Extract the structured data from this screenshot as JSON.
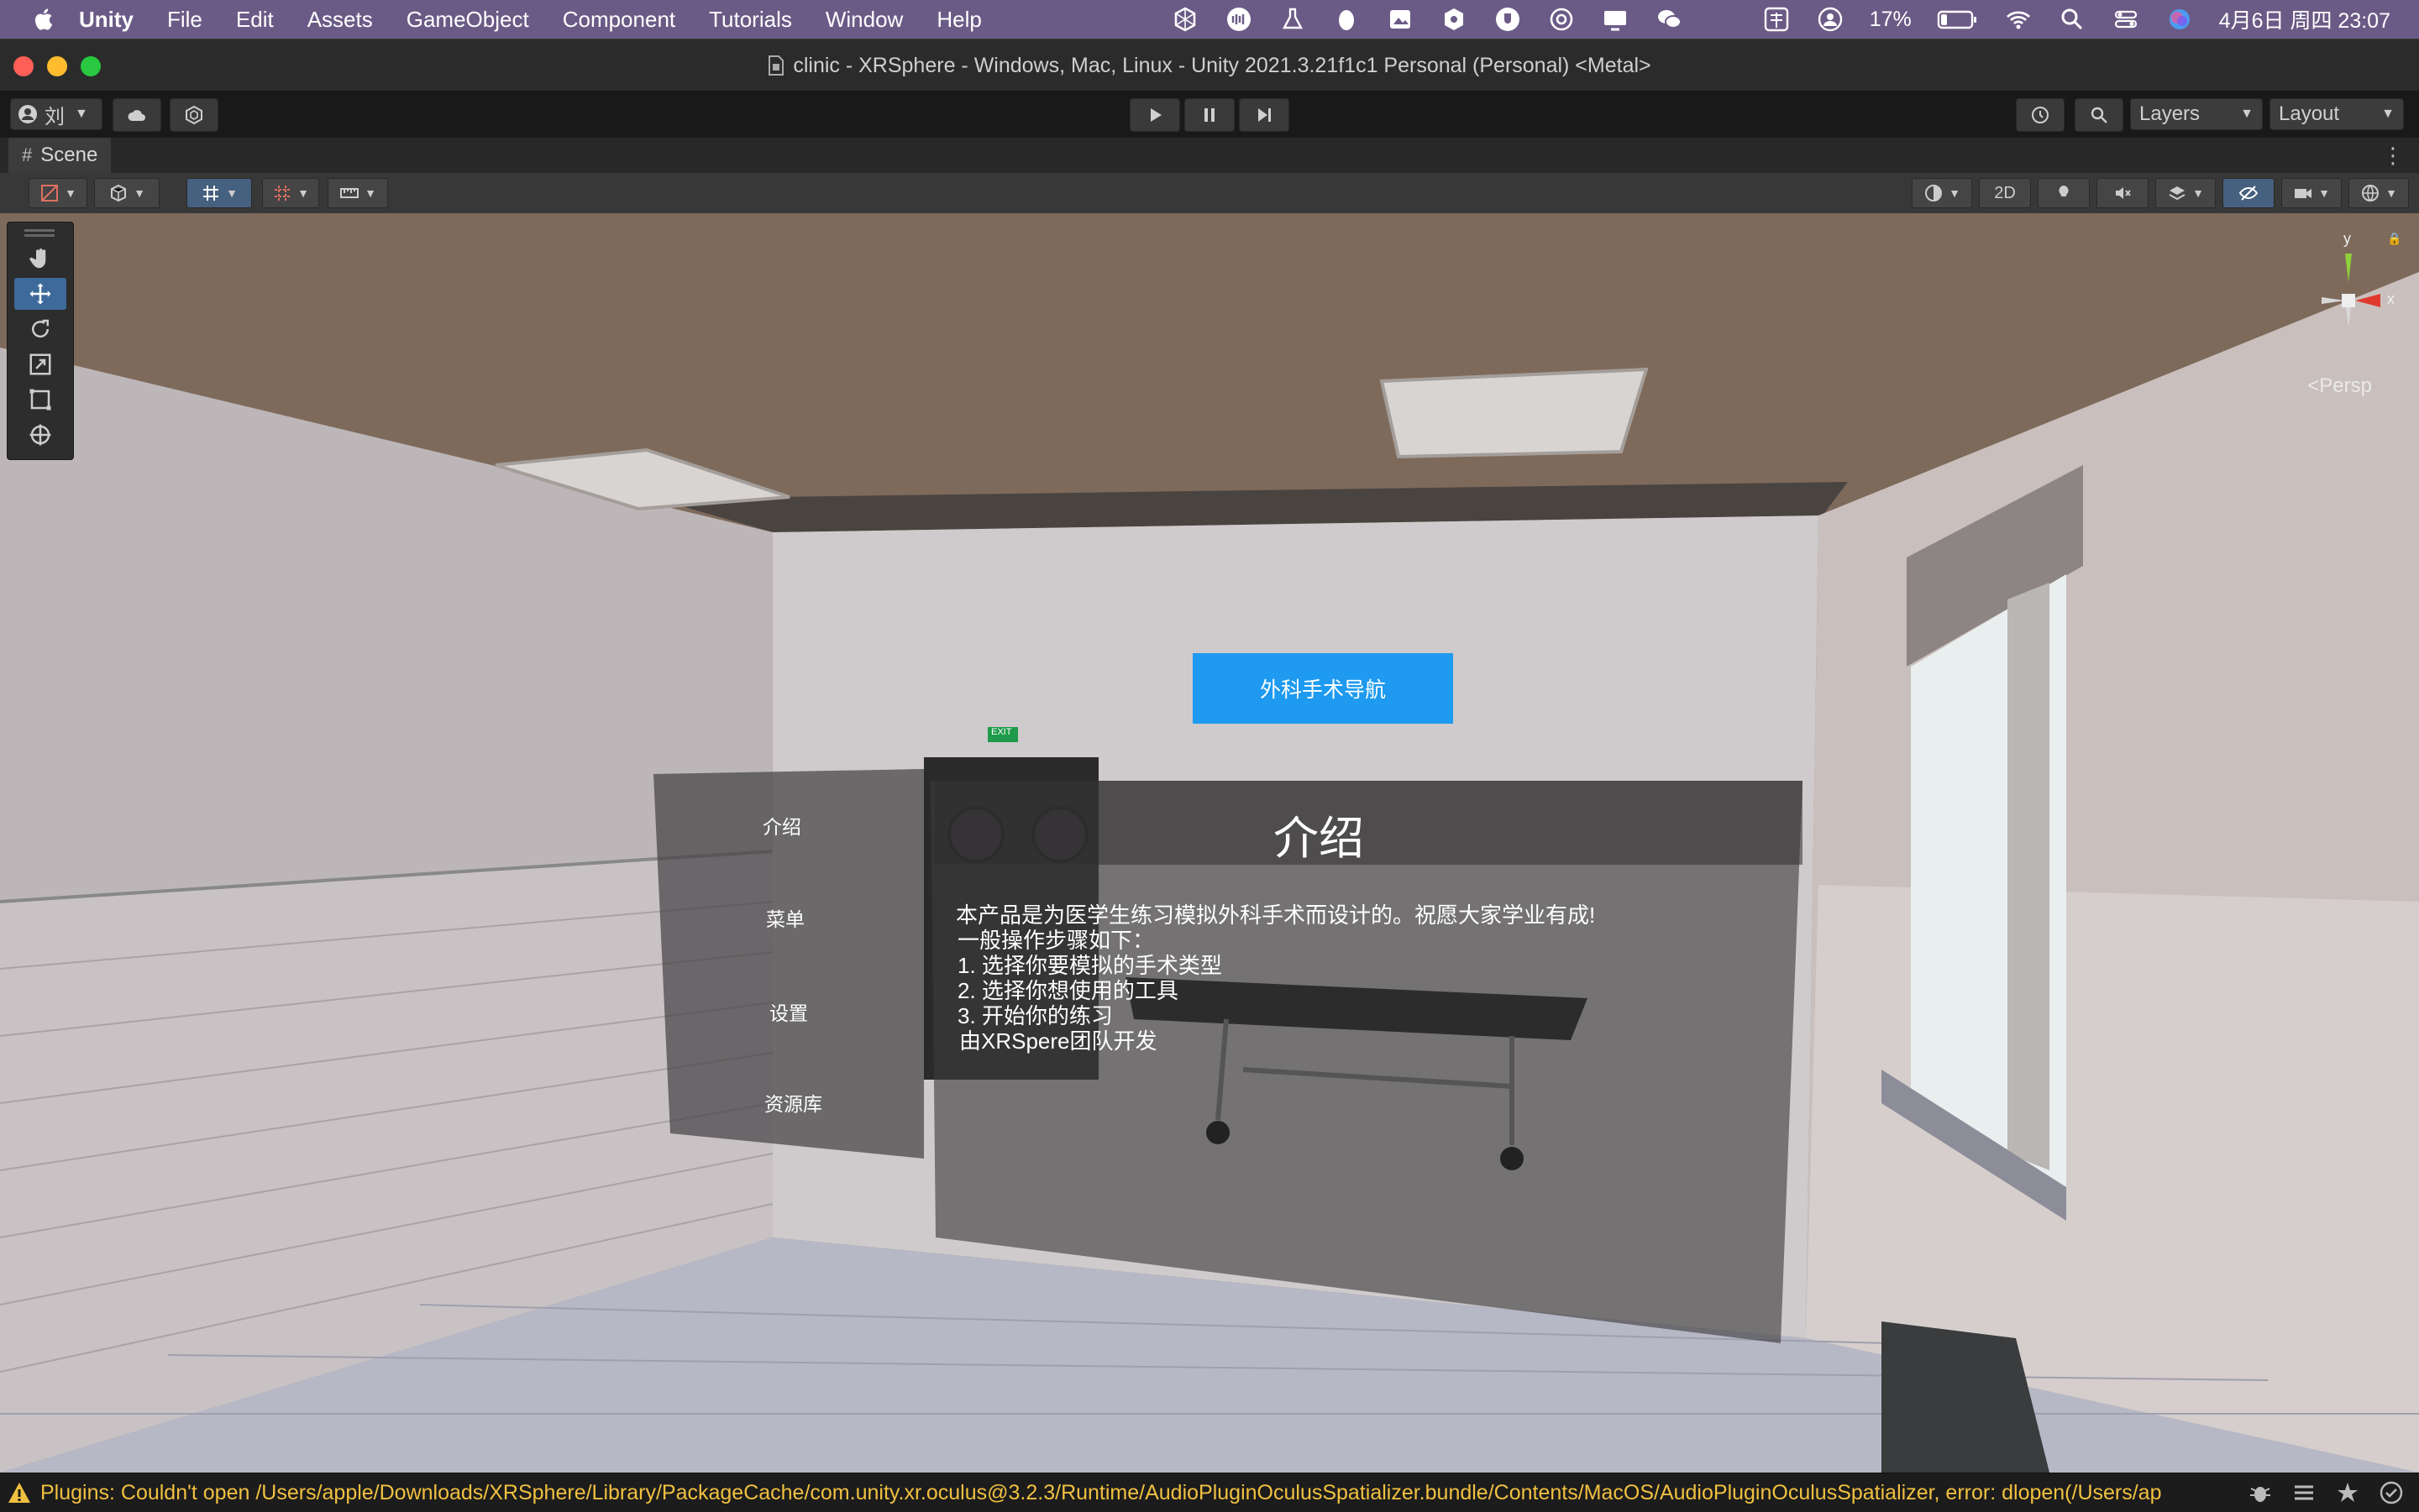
{
  "menubar": {
    "items": [
      "Unity",
      "File",
      "Edit",
      "Assets",
      "GameObject",
      "Component",
      "Tutorials",
      "Window",
      "Help"
    ],
    "battery": "17%",
    "datetime": "4月6日 周四  23:07"
  },
  "window": {
    "title": "clinic - XRSphere - Windows, Mac, Linux - Unity 2021.3.21f1c1 Personal (Personal) <Metal>"
  },
  "toolbar": {
    "account_label": "刘",
    "layers_label": "Layers",
    "layout_label": "Layout"
  },
  "scene_tab": {
    "label": "Scene"
  },
  "scene_toolbar": {
    "mode_2d": "2D"
  },
  "gizmo": {
    "y_label": "y",
    "x_label": "x",
    "projection": "Persp"
  },
  "scene_ui": {
    "nav_button": "外科手术导航",
    "exit_sign": "EXIT",
    "menu": [
      "介绍",
      "菜单",
      "设置",
      "资源库"
    ],
    "panel_title": "介绍",
    "panel_lines": [
      "本产品是为医学生练习模拟外科手术而设计的。祝愿大家学业有成!",
      "一般操作步骤如下：",
      "1. 选择你要模拟的手术类型",
      "2. 选择你想使用的工具",
      "3. 开始你的练习",
      "由XRSpere团队开发"
    ]
  },
  "statusbar": {
    "message": "Plugins: Couldn't open /Users/apple/Downloads/XRSphere/Library/PackageCache/com.unity.xr.oculus@3.2.3/Runtime/AudioPluginOculusSpatializer.bundle/Contents/MacOS/AudioPluginOculusSpatializer, error: dlopen(/Users/ap"
  },
  "colors": {
    "menubar_bg": "#6a5b86",
    "accent_blue": "#1e9af0",
    "warning_yellow": "#f0c040"
  }
}
